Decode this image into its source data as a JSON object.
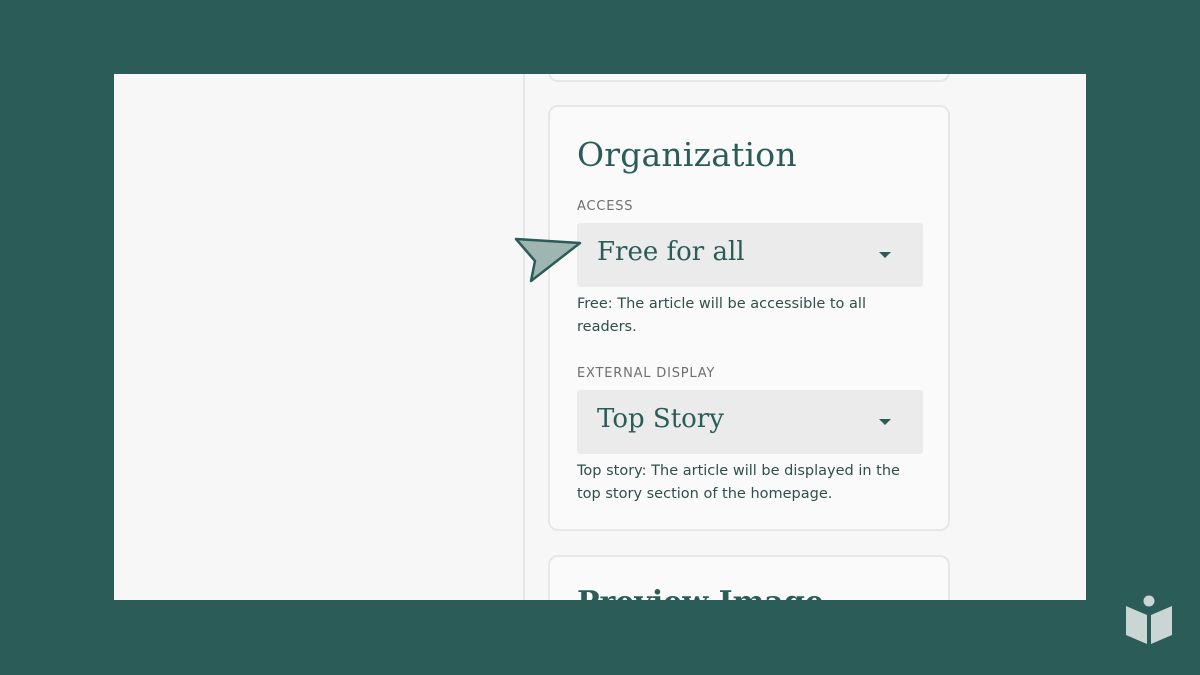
{
  "organization": {
    "title": "Organization",
    "access": {
      "label": "ACCESS",
      "value": "Free for all",
      "help": "Free: The article will be accessible to all readers."
    },
    "external_display": {
      "label": "EXTERNAL DISPLAY",
      "value": "Top Story",
      "help": "Top story: The article will be displayed in the top story section of the homepage."
    }
  },
  "next_card": {
    "title": "Preview Image"
  },
  "icons": {
    "dropdown": "caret-down-icon",
    "pointer": "pointer-arrow-icon",
    "logo": "reader-book-logo-icon"
  },
  "colors": {
    "brand": "#2b5c57",
    "background": "#2b5c57",
    "card": "#fafafa",
    "select_bg": "#ebebeb"
  }
}
